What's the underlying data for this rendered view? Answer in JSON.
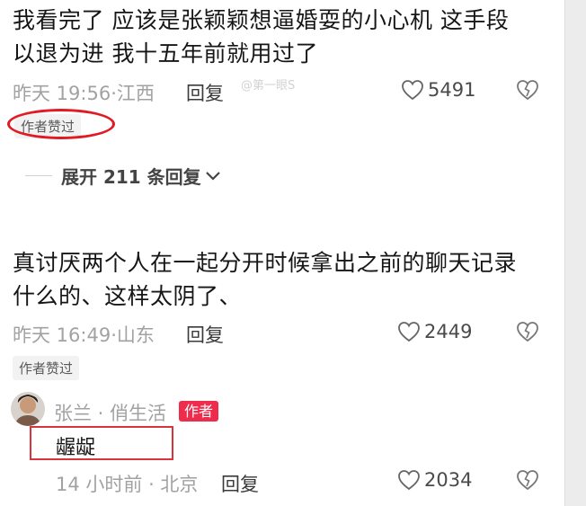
{
  "comment1": {
    "line1": "我看完了 应该是张颖颖想逼婚耍的小心机 这手段",
    "line2": "以退为进 我十五年前就用过了",
    "meta": "昨天 19:56·江西",
    "reply_label": "回复",
    "watermark": "@第一眼S",
    "likes": "5491",
    "author_liked": "作者赞过",
    "expand_label": "展开 211 条回复"
  },
  "comment2": {
    "line1": "真讨厌两个人在一起分开时候拿出之前的聊天记录",
    "line2": "什么的、这样太阴了、",
    "meta": "昨天 16:49·山东",
    "reply_label": "回复",
    "likes": "2449",
    "author_liked": "作者赞过"
  },
  "reply": {
    "name": "张兰 · 俏生活",
    "author_tag": "作者",
    "text": "龌龊",
    "meta": "14 小时前 · 北京",
    "reply_label": "回复",
    "likes": "2034"
  },
  "colors": {
    "accent_red": "#ee2d4c",
    "annotation_red": "#e01b24"
  }
}
